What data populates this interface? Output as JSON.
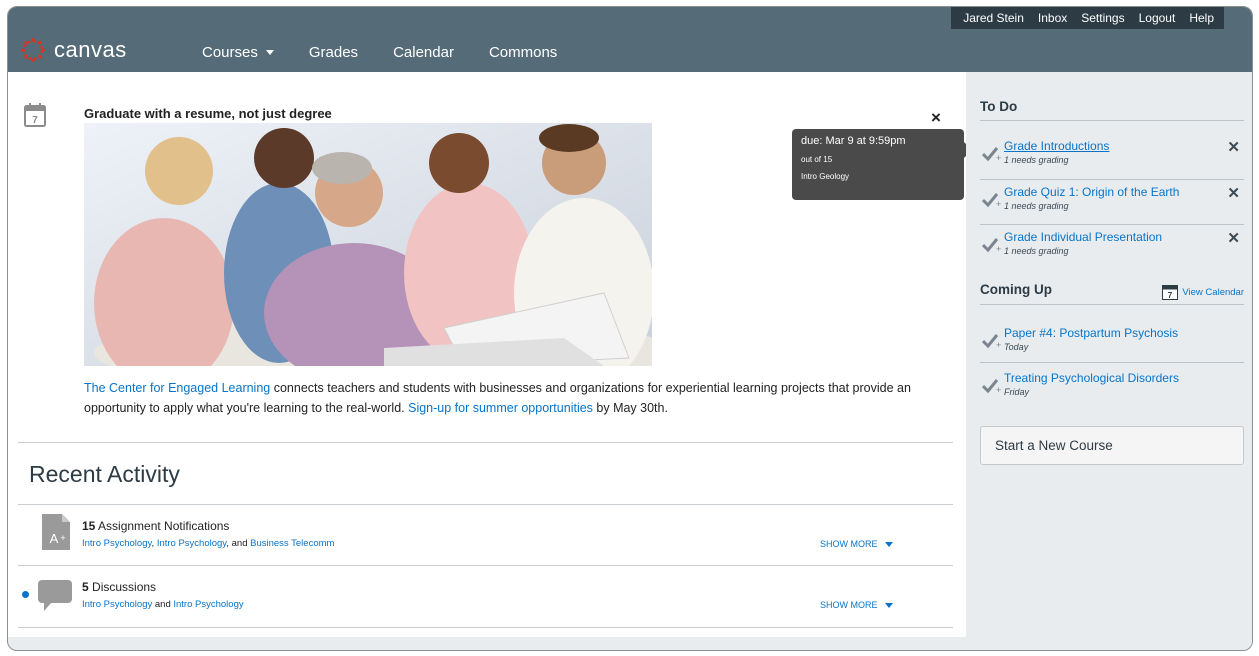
{
  "user_menu": {
    "user": "Jared Stein",
    "inbox": "Inbox",
    "settings": "Settings",
    "logout": "Logout",
    "help": "Help"
  },
  "brand": {
    "name": "canvas"
  },
  "nav": {
    "courses": "Courses",
    "grades": "Grades",
    "calendar": "Calendar",
    "commons": "Commons"
  },
  "announcement": {
    "calendar_day": "7",
    "title": "Graduate with a resume, not just degree",
    "close": "×",
    "text": {
      "link1": "The Center for Engaged Learning",
      "part1": " connects teachers and students with businesses and organizations for experiential learning projects that provide an opportunity to apply what you're learning to the real-world. ",
      "link2": "Sign-up for summer opportunities",
      "part2": " by May 30th."
    }
  },
  "tooltip": {
    "due": "due: Mar 9 at 9:59pm",
    "points": "out of 15",
    "course": "Intro Geology"
  },
  "recent_activity": {
    "title": "Recent Activity",
    "items": [
      {
        "count": "15",
        "label": " Assignment Notifications",
        "link_a": "Intro Psychology",
        "sep_a": ", ",
        "link_b": "Intro Psychology",
        "sep_b": ", and ",
        "link_c": "Business Telecomm",
        "more": "SHOW MORE"
      },
      {
        "count": "5",
        "label": " Discussions",
        "link_a": "Intro Psychology",
        "sep_a": " and ",
        "link_b": "Intro Psychology",
        "more": "SHOW MORE"
      }
    ]
  },
  "sidebar": {
    "todo_heading": "To Do",
    "todo": [
      {
        "title": "Grade Introductions",
        "sub": "1 needs grading"
      },
      {
        "title": "Grade Quiz 1: Origin of the Earth",
        "sub": "1 needs grading"
      },
      {
        "title": "Grade Individual Presentation",
        "sub": "1 needs grading"
      }
    ],
    "coming_heading": "Coming Up",
    "view_calendar": "View Calendar",
    "calendar_day": "7",
    "coming": [
      {
        "title": "Paper #4: Postpartum Psychosis",
        "sub": "Today"
      },
      {
        "title": "Treating Psychological Disorders",
        "sub": "Friday"
      }
    ],
    "new_course": "Start a New Course"
  },
  "colors": {
    "header": "#566b78",
    "userbar": "#2d3b45",
    "link": "#0774c9",
    "sidebar": "#e9ecef",
    "brand_red": "#e0301e"
  }
}
